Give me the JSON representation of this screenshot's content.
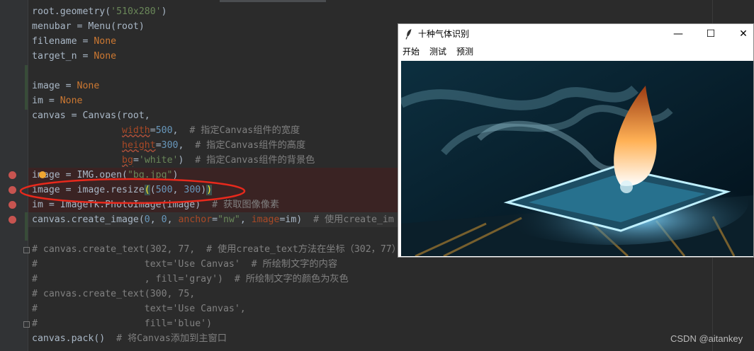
{
  "code_lines": [
    {
      "html": "root.geometry(<span class=\"str\">'510x280'</span>)"
    },
    {
      "html": "menubar = Menu(root)"
    },
    {
      "html": "filename = <span class=\"kw\">None</span>"
    },
    {
      "html": "target_n = <span class=\"kw\">None</span>"
    },
    {
      "html": ""
    },
    {
      "html": "image = <span class=\"kw\">None</span>"
    },
    {
      "html": "im = <span class=\"kw\">None</span>"
    },
    {
      "html": "canvas = Canvas(root,"
    },
    {
      "html": "                <span class=\"prm wavy\">width</span>=<span class=\"num\">500</span>,  <span class=\"cmt\"># 指定Canvas组件的宽度</span>"
    },
    {
      "html": "                <span class=\"prm wavy\">height</span>=<span class=\"num\">300</span>,  <span class=\"cmt\"># 指定Canvas组件的高度</span>"
    },
    {
      "html": "                <span class=\"prm wavy\">bg</span>=<span class=\"str\">'white'</span>)  <span class=\"cmt\"># 指定Canvas组件的背景色</span>"
    },
    {
      "html": "image = IMG.open(<span class=\"str\">\"bg.jpg\"</span>)"
    },
    {
      "html": "image = image.resize<span class=\"paren-hl\">(</span>(<span class=\"num\">500</span>, <span class=\"num\">300</span>)<span class=\"paren-hl\">)</span>"
    },
    {
      "html": "im = ImageTk.PhotoImage(image)  <span class=\"cmt\"># 获取图像像素</span>"
    },
    {
      "html": "canvas.create_image(<span class=\"num\">0</span>, <span class=\"num\">0</span>, <span class=\"prm\">anchor</span>=<span class=\"str\">\"nw\"</span>, <span class=\"prm\">image</span>=im)  <span class=\"cmt\"># 使用create_im</span>"
    },
    {
      "html": ""
    },
    {
      "html": "<span class=\"cmt\"># canvas.create_text(302, 77,  # 使用create_text方法在坐标（302，77）</span>"
    },
    {
      "html": "<span class=\"cmt\">#                   text='Use Canvas'  # 所绘制文字的内容</span>"
    },
    {
      "html": "<span class=\"cmt\">#                   , fill='gray')  # 所绘制文字的颜色为灰色</span>"
    },
    {
      "html": "<span class=\"cmt\"># canvas.create_text(300, 75,</span>"
    },
    {
      "html": "<span class=\"cmt\">#                   text='Use Canvas',</span>"
    },
    {
      "html": "<span class=\"cmt\">#                   fill='blue')</span>"
    },
    {
      "html": "canvas.pack()  <span class=\"cmt\"># 将Canvas添加到主窗口</span>"
    }
  ],
  "watermark": "CSDN @aitankey",
  "window": {
    "title": "十种气体识别",
    "minimize_glyph": "—",
    "maximize_glyph": "☐",
    "close_glyph": "✕",
    "menu": [
      "开始",
      "测试",
      "预测"
    ]
  },
  "icons": {
    "window_icon": "feather-icon",
    "breakpoint": "breakpoint-dot-icon",
    "intention": "lightbulb-icon"
  },
  "colors": {
    "editor_bg": "#2b2b2b",
    "breakpoint": "#c75450",
    "annotation": "#e8291c"
  }
}
